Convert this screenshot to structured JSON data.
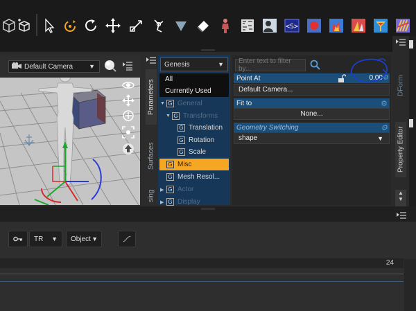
{
  "toolbar": {
    "icons": [
      "cube-icon",
      "select-arrow-icon",
      "rotate-tool-icon",
      "universal-rotate-icon",
      "translate-icon",
      "node-select-icon",
      "joint-editor-icon",
      "triangle-icon",
      "eraser-icon",
      "figure-icon",
      "texture-icon",
      "person-icon",
      "script-icon",
      "render-icon",
      "fire-icon",
      "stage-icon",
      "magnet-icon",
      "morph-icon"
    ]
  },
  "viewport": {
    "camera": "Default Camera"
  },
  "side_tabs": {
    "parameters": "Parameters",
    "surfaces": "Surfaces",
    "posing": "sing"
  },
  "tree": {
    "figure_select": "Genesis",
    "all": "All",
    "currently_used": "Currently Used",
    "items": [
      {
        "label": "General"
      },
      {
        "label": "Transforms"
      },
      {
        "label": "Translation"
      },
      {
        "label": "Rotation"
      },
      {
        "label": "Scale"
      },
      {
        "label": "Misc"
      },
      {
        "label": "Mesh Resol..."
      },
      {
        "label": "Actor"
      },
      {
        "label": "Display"
      }
    ]
  },
  "properties": {
    "filter_placeholder": "Enter text to filter by...",
    "point_at_label": "Point At",
    "point_at_value": "0.00",
    "point_at_target": "Default Camera...",
    "fit_to_label": "Fit to",
    "fit_to_value": "None...",
    "geometry_switching_label": "Geometry Switching",
    "geometry_switching_value": "shape"
  },
  "right_tabs": {
    "dform": "DForm",
    "property_editor": "Property Editor"
  },
  "timeline": {
    "key_icon": "key-icon",
    "tr_select": "TR",
    "object_select": "Object",
    "end_frame": "24"
  },
  "colors": {
    "selection": "#f5a623",
    "tree_bg": "#163758",
    "section_bg": "#1c4e7a",
    "accent": "#5b9bd5"
  }
}
